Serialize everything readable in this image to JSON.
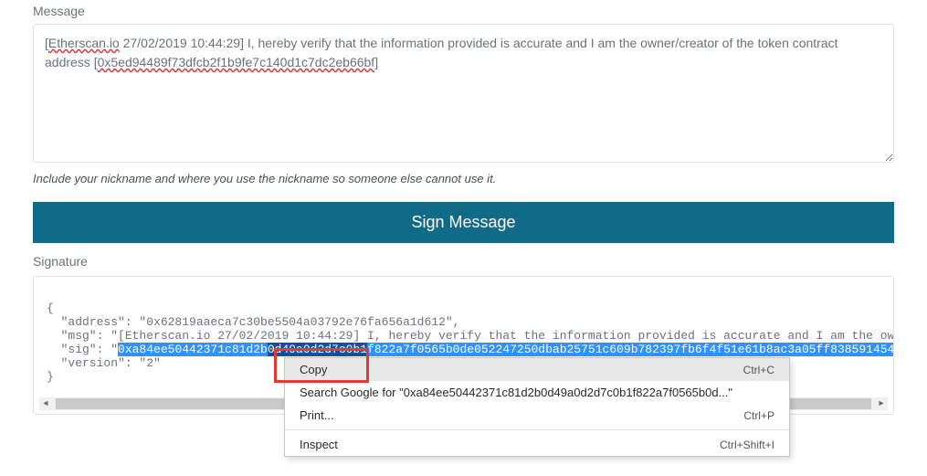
{
  "message": {
    "label": "Message",
    "val_prefix": "[",
    "val_domain": "Etherscan.io",
    "val_ts": " 27/02/2019 10:44:29] I, hereby verify that the information provided is accurate and I am the owner/creator of the token contract address [",
    "val_addr": "0x5ed94489f73dfcb2f1b9fe7c140d1c7dc2eb66bf",
    "val_suffix": "]",
    "hint": "Include your nickname and where you use the nickname so someone else cannot use it."
  },
  "sign_button": "Sign Message",
  "signature": {
    "label": "Signature",
    "line_open": "{",
    "line_addr": "  \"address\": \"0x62819aaeca7c30be5504a03792e76fa656a1d612\",",
    "line_msg": "  \"msg\": \"[Etherscan.io 27/02/2019 10:44:29] I, hereby verify that the information provided is accurate and I am the ow",
    "line_sig_pref": "  \"sig\": \"",
    "line_sig_vis": "0xa84ee50442371c81d2b",
    "line_sig_obs": "0d49a0d2d7c0b1",
    "line_sig_rest": "f822a7f0565b0de052247250dbab25751c609b782397fb6f4f51e61b8ac3a05ff838591454",
    "line_ver": "  \"version\": \"2\"",
    "line_close": "}"
  },
  "context_menu": {
    "copy": "Copy",
    "copy_sc": "Ctrl+C",
    "search": "Search Google for \"0xa84ee50442371c81d2b0d49a0d2d7c0b1f822a7f0565b0d...\"",
    "print": "Print...",
    "print_sc": "Ctrl+P",
    "inspect": "Inspect",
    "inspect_sc": "Ctrl+Shift+I"
  }
}
